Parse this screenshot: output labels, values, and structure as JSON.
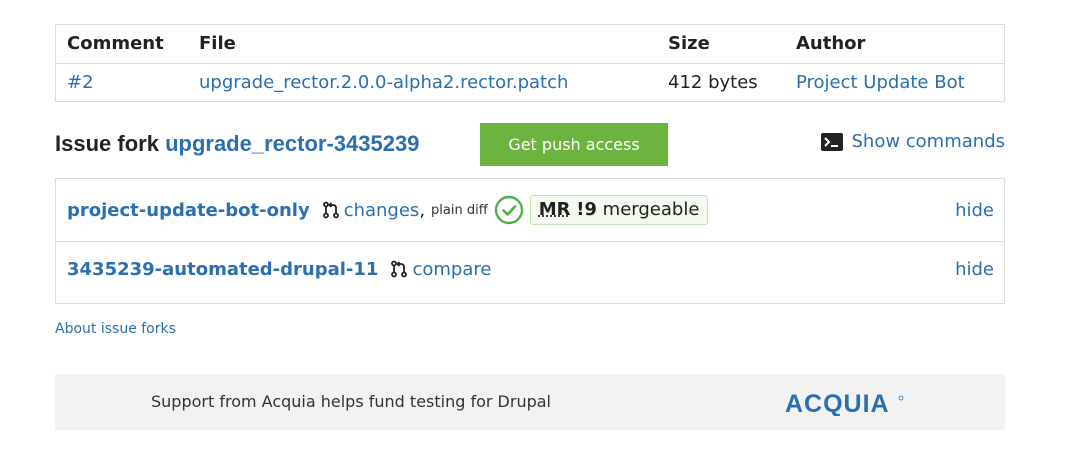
{
  "files_table": {
    "headers": {
      "comment": "Comment",
      "file": "File",
      "size": "Size",
      "author": "Author"
    },
    "rows": [
      {
        "comment": "#2",
        "file": "upgrade_rector.2.0.0-alpha2.rector.patch",
        "size": "412 bytes",
        "author": "Project Update Bot"
      }
    ]
  },
  "fork": {
    "title_prefix": "Issue fork",
    "name": "upgrade_rector-3435239",
    "push_button": "Get push access",
    "show_commands": "Show commands"
  },
  "branches": [
    {
      "name": "project-update-bot-only",
      "changes_link": "changes",
      "separator": ",",
      "plain_diff": "plain diff",
      "mr_label": "MR",
      "mr_number": "!9",
      "mr_status": "mergeable",
      "hide": "hide"
    },
    {
      "name": "3435239-automated-drupal-11",
      "compare_link": "compare",
      "hide": "hide"
    }
  ],
  "about_link": "About issue forks",
  "sponsor": {
    "text": "Support from Acquia helps fund testing for Drupal",
    "logo_text": "ACQUIA"
  },
  "colors": {
    "link": "#2a6fb0",
    "button_green": "#6db33f",
    "mergeable_green": "#4caf50",
    "sponsor_bg": "#f2f2f2"
  },
  "icons": {
    "terminal": "terminal-icon",
    "merge_request": "merge-request-icon",
    "check": "check-circle-icon"
  }
}
